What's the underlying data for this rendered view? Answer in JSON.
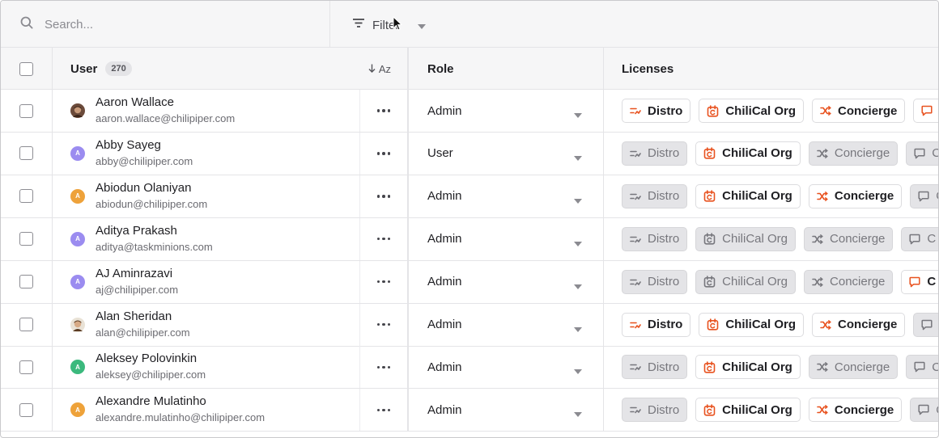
{
  "toolbar": {
    "search_placeholder": "Search...",
    "filter_label": "Filter"
  },
  "header": {
    "user": "User",
    "user_count": "270",
    "sort_label": "Az",
    "role": "Role",
    "licenses": "Licenses"
  },
  "license_names": {
    "distro": "Distro",
    "chilical": "ChiliCal Org",
    "concierge": "Concierge"
  },
  "colors": {
    "accent": "#e8521f",
    "muted": "#77777d",
    "avatar_purple": "#9b8cf0",
    "avatar_orange": "#eea23a",
    "avatar_green": "#3bb97d"
  },
  "rows": [
    {
      "name": "Aaron Wallace",
      "email": "aaron.wallace@chilipiper.com",
      "role": "Admin",
      "avatar": "photo-brown",
      "initial": "",
      "distro": true,
      "chilical": true,
      "concierge": true,
      "chat": true
    },
    {
      "name": "Abby Sayeg",
      "email": "abby@chilipiper.com",
      "role": "User",
      "avatar": "purple",
      "initial": "A",
      "distro": false,
      "chilical": true,
      "concierge": false,
      "chat": false
    },
    {
      "name": "Abiodun Olaniyan",
      "email": "abiodun@chilipiper.com",
      "role": "Admin",
      "avatar": "orange",
      "initial": "A",
      "distro": false,
      "chilical": true,
      "concierge": true,
      "chat": false
    },
    {
      "name": "Aditya Prakash",
      "email": "aditya@taskminions.com",
      "role": "Admin",
      "avatar": "purple",
      "initial": "A",
      "distro": false,
      "chilical": false,
      "concierge": false,
      "chat": false
    },
    {
      "name": "AJ Aminrazavi",
      "email": "aj@chilipiper.com",
      "role": "Admin",
      "avatar": "purple",
      "initial": "A",
      "distro": false,
      "chilical": false,
      "concierge": false,
      "chat": true
    },
    {
      "name": "Alan Sheridan",
      "email": "alan@chilipiper.com",
      "role": "Admin",
      "avatar": "photo-tan",
      "initial": "",
      "distro": true,
      "chilical": true,
      "concierge": true,
      "chat": false
    },
    {
      "name": "Aleksey Polovinkin",
      "email": "aleksey@chilipiper.com",
      "role": "Admin",
      "avatar": "green",
      "initial": "A",
      "distro": false,
      "chilical": true,
      "concierge": false,
      "chat": false
    },
    {
      "name": "Alexandre Mulatinho",
      "email": "alexandre.mulatinho@chilipiper.com",
      "role": "Admin",
      "avatar": "orange",
      "initial": "A",
      "distro": false,
      "chilical": true,
      "concierge": true,
      "chat": false
    }
  ]
}
